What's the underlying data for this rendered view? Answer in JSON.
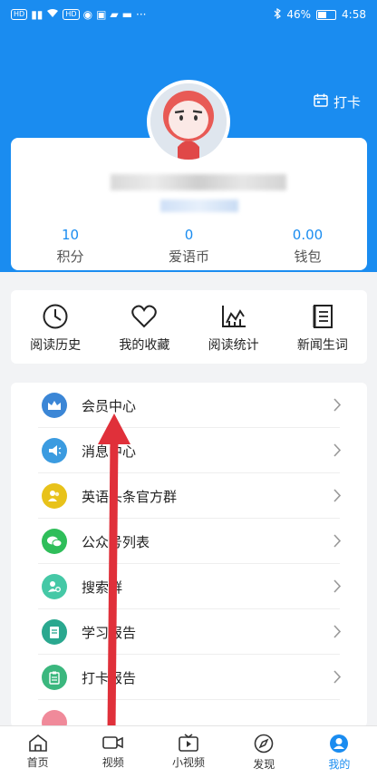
{
  "status_bar": {
    "left_badges": [
      "HD",
      "HD"
    ],
    "battery": "46%",
    "time": "4:58",
    "more": "···"
  },
  "header": {
    "checkin_label": "打卡"
  },
  "profile": {
    "stats": [
      {
        "value": "10",
        "label": "积分"
      },
      {
        "value": "0",
        "label": "爱语币"
      },
      {
        "value": "0.00",
        "label": "钱包"
      }
    ]
  },
  "shortcuts": [
    {
      "label": "阅读历史",
      "icon": "clock-icon"
    },
    {
      "label": "我的收藏",
      "icon": "heart-icon"
    },
    {
      "label": "阅读统计",
      "icon": "chart-icon"
    },
    {
      "label": "新闻生词",
      "icon": "notebook-icon"
    }
  ],
  "menu": [
    {
      "label": "会员中心",
      "icon": "crown-icon",
      "color": "#3b86d6"
    },
    {
      "label": "消息中心",
      "icon": "megaphone-icon",
      "color": "#3b9be0"
    },
    {
      "label": "英语头条官方群",
      "icon": "group-icon",
      "color": "#e8c21a"
    },
    {
      "label": "公众号列表",
      "icon": "wechat-icon",
      "color": "#2fbe5a"
    },
    {
      "label": "搜索群",
      "icon": "search-group-icon",
      "color": "#45c8a6"
    },
    {
      "label": "学习报告",
      "icon": "report-icon",
      "color": "#2aa88f"
    },
    {
      "label": "打卡报告",
      "icon": "clipboard-icon",
      "color": "#3bb77e"
    }
  ],
  "bottom_nav": [
    {
      "label": "首页",
      "icon": "home-icon"
    },
    {
      "label": "视频",
      "icon": "video-icon"
    },
    {
      "label": "小视频",
      "icon": "tv-icon"
    },
    {
      "label": "发现",
      "icon": "compass-icon"
    },
    {
      "label": "我的",
      "icon": "profile-icon"
    }
  ],
  "colors": {
    "accent": "#1a8cf0",
    "annotation_arrow": "#e0303a"
  }
}
